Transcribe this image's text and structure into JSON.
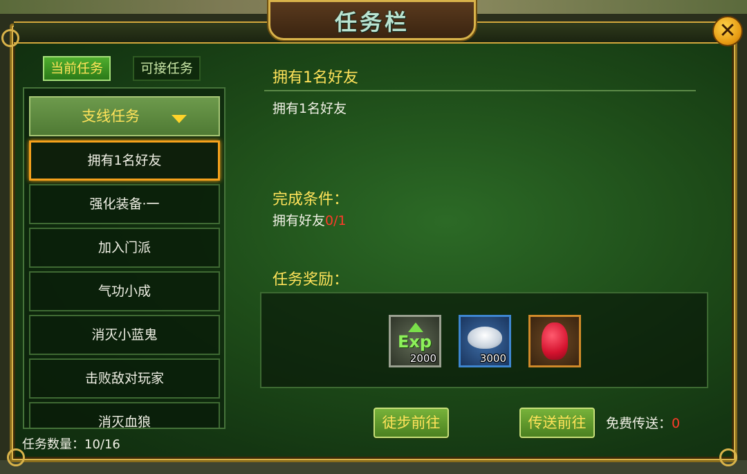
{
  "window": {
    "title": "任务栏",
    "close_icon": "close-icon"
  },
  "tabs": {
    "current": "当前任务",
    "available": "可接任务"
  },
  "quest_list": {
    "category": "支线任务",
    "items": [
      "拥有1名好友",
      "强化装备·一",
      "加入门派",
      "气功小成",
      "消灭小蓝鬼",
      "击败敌对玩家",
      "消灭血狼"
    ],
    "selected_index": 0,
    "count_label": "任务数量：",
    "count_value": "10/16"
  },
  "detail": {
    "title": "拥有1名好友",
    "description": "拥有1名好友",
    "condition_label": "完成条件：",
    "condition_text": "拥有好友",
    "condition_progress": "0/1",
    "reward_label": "任务奖励：",
    "rewards": [
      {
        "icon": "exp-icon",
        "icon_text": "Exp",
        "amount": "2000"
      },
      {
        "icon": "silver-ingot-icon",
        "amount": "3000"
      },
      {
        "icon": "red-gem-icon",
        "amount": ""
      }
    ]
  },
  "actions": {
    "walk": "徒步前往",
    "teleport": "传送前往",
    "free_teleport_label": "免费传送：",
    "free_teleport_value": "0"
  },
  "colors": {
    "accent": "#ffe35a",
    "alert": "#ff3b2a",
    "selected_border": "#f5a11c"
  }
}
